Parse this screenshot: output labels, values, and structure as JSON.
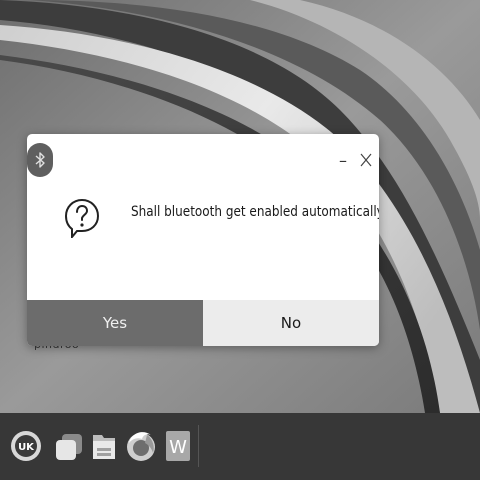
{
  "desktop": {
    "icon_label": "pindroo"
  },
  "dialog": {
    "message": "Shall bluetooth get enabled automatically?",
    "minimize_glyph": "–",
    "close_glyph": "X",
    "yes_label": "Yes",
    "no_label": "No",
    "icons": [
      "bluetooth-icon",
      "question-speech-bubble-icon",
      "minimize-icon",
      "close-icon"
    ]
  },
  "taskbar": {
    "items": [
      {
        "name": "start-menu",
        "icon": "uk-logo-icon",
        "text": "UK"
      },
      {
        "name": "show-desktop",
        "icon": "windows-stack-icon"
      },
      {
        "name": "file-manager",
        "icon": "folder-icon"
      },
      {
        "name": "firefox",
        "icon": "firefox-icon"
      },
      {
        "name": "office-writer",
        "icon": "writer-icon",
        "text": "W"
      }
    ]
  },
  "colors": {
    "dialog_bg": "#ffffff",
    "yes_button_bg": "#6c6c6c",
    "no_button_bg": "#ececec",
    "taskbar_bg": "#373737",
    "bluetooth_badge_bg": "#5f5f5f"
  }
}
